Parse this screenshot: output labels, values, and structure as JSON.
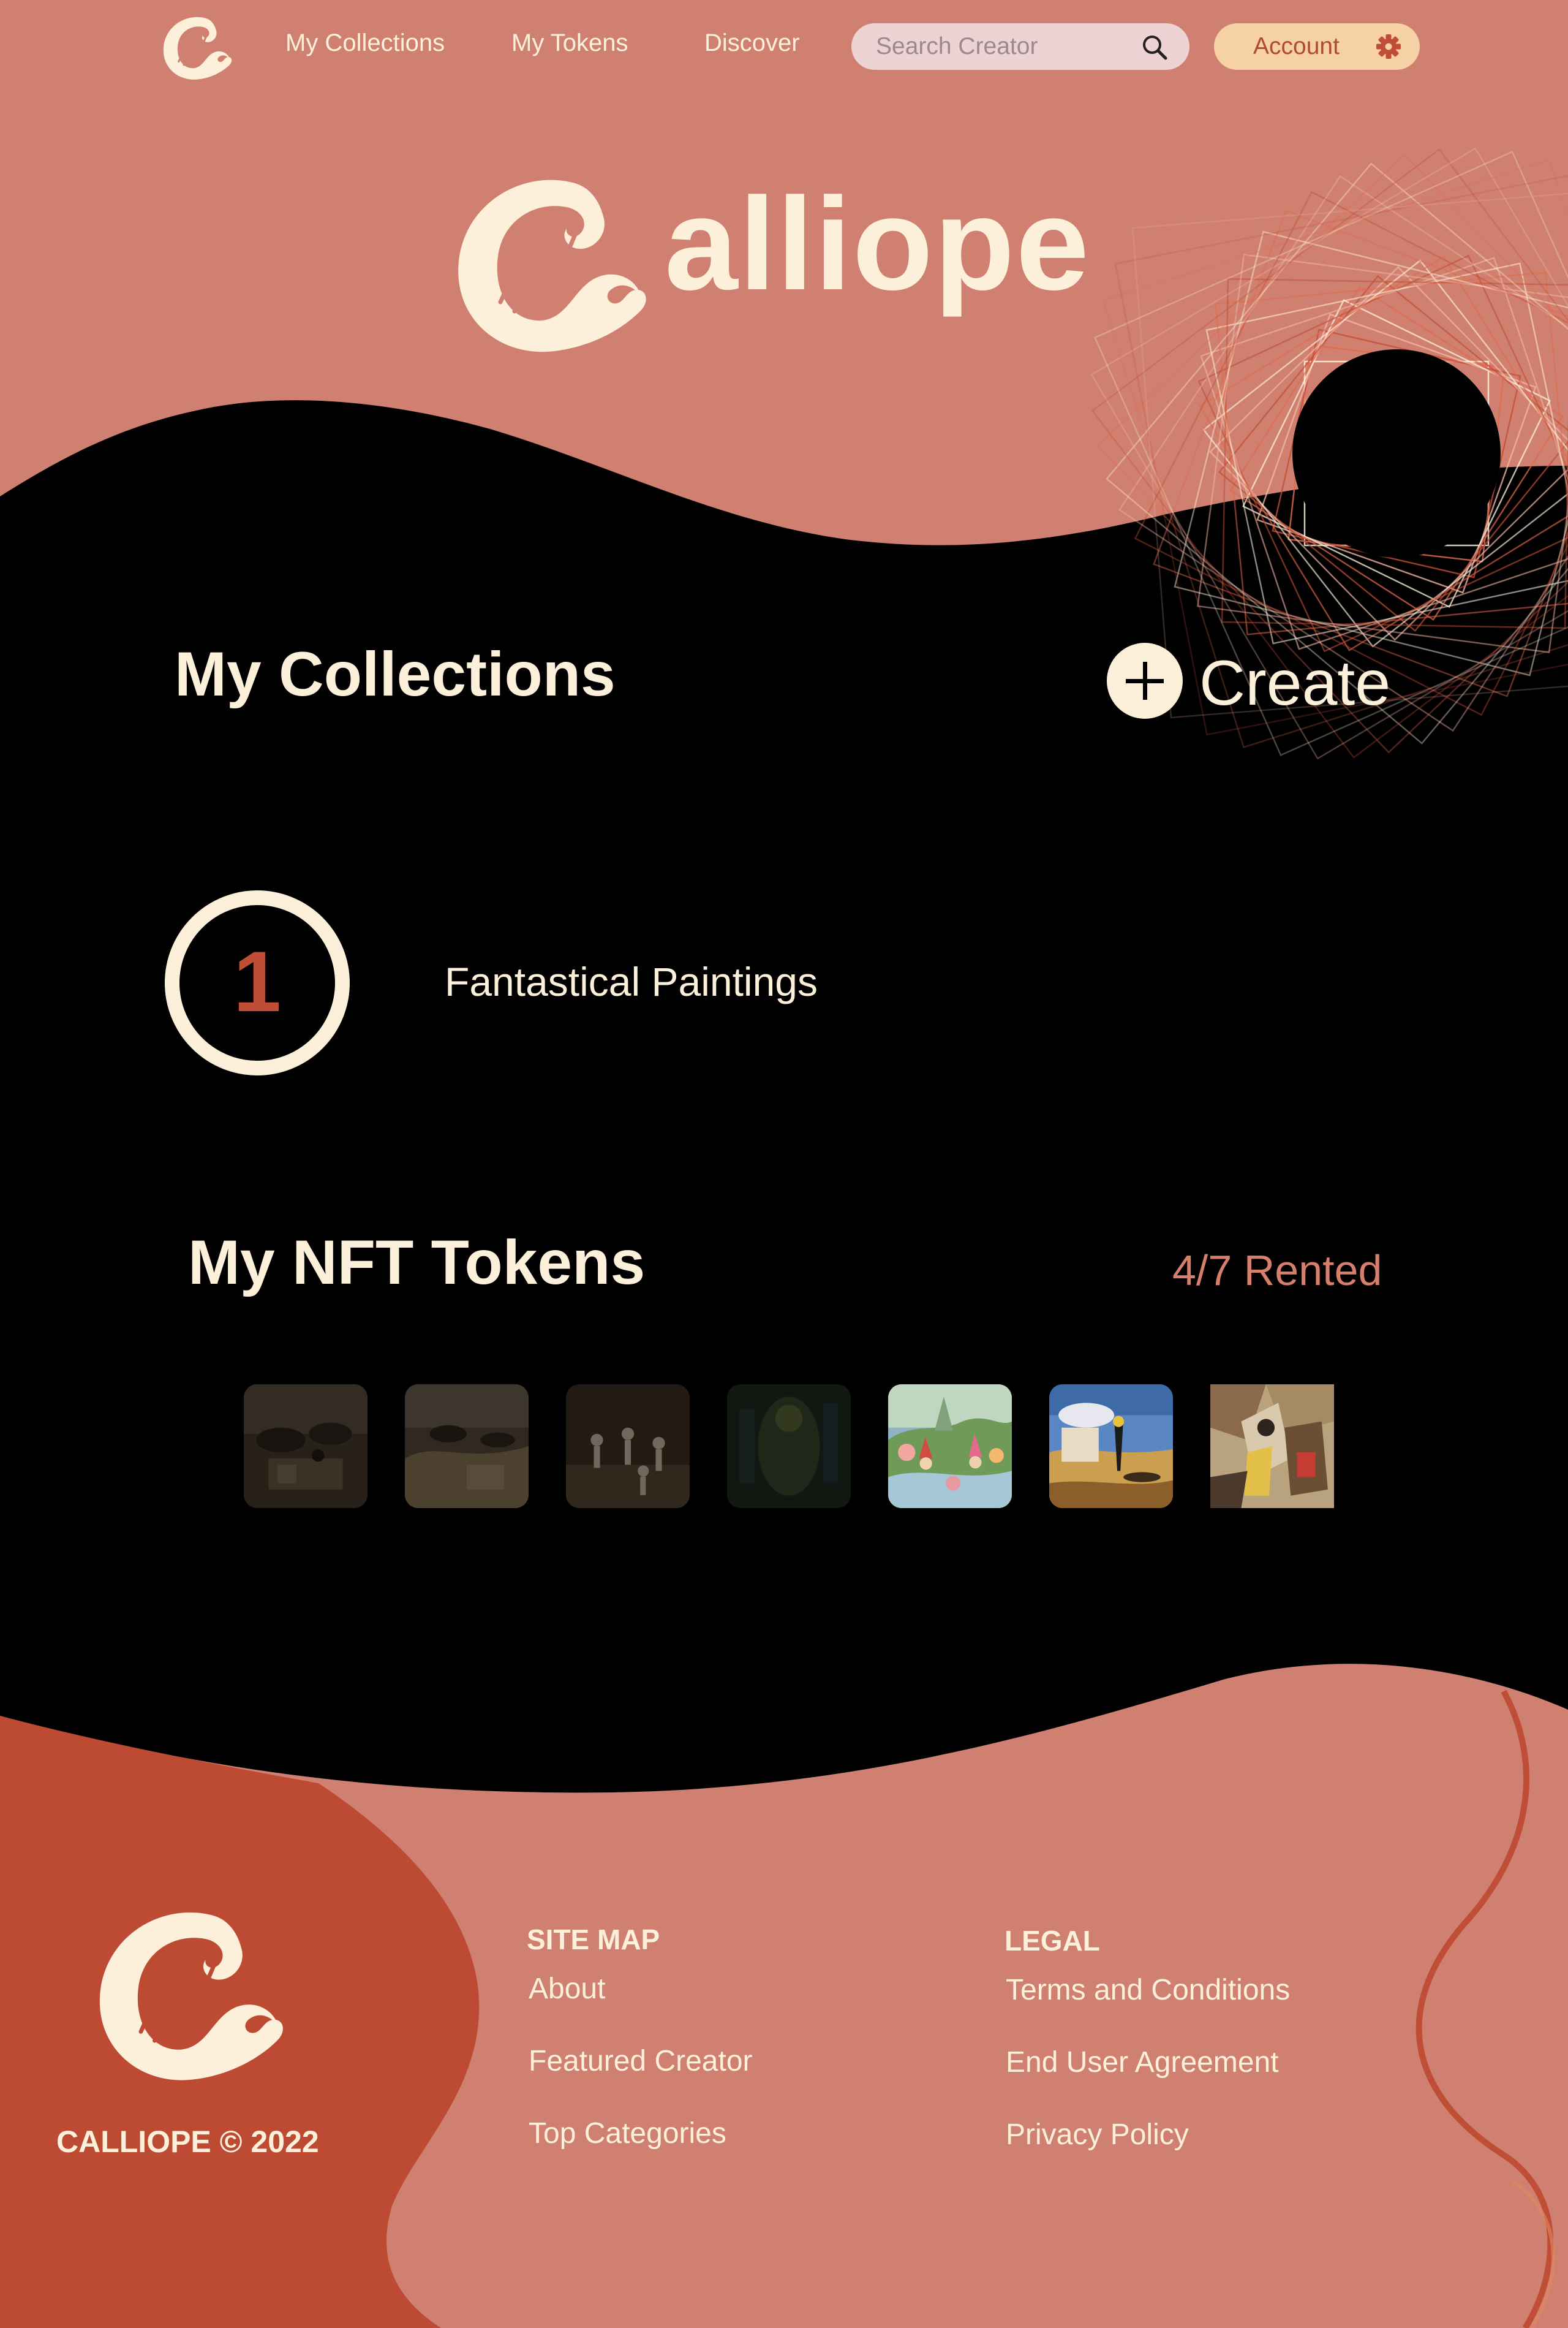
{
  "colors": {
    "salmon": "#d08070",
    "brick": "#bd4a33",
    "cream": "#fdf0da",
    "black": "#000000",
    "account_bg": "#f6d1a5",
    "search_bg": "#eed3d4"
  },
  "nav": {
    "logo_icon": "calliope-harp-logo-icon",
    "links": [
      "My Collections",
      "My Tokens",
      "Discover"
    ],
    "search": {
      "placeholder": "Search Creator",
      "icon": "search-icon"
    },
    "account": {
      "label": "Account",
      "icon": "gear-icon"
    }
  },
  "hero": {
    "word": "alliope",
    "logo_icon": "calliope-harp-logo-icon"
  },
  "collections": {
    "title": "My Collections",
    "create_label": "Create",
    "create_icon": "plus-icon",
    "items": [
      {
        "number": "1",
        "name": "Fantastical Paintings"
      }
    ]
  },
  "tokens": {
    "title": "My NFT Tokens",
    "rented": "4/7 Rented",
    "items": [
      {
        "art": "sepia-figures-scene",
        "dimmed": true
      },
      {
        "art": "sepia-desert-scene",
        "dimmed": true
      },
      {
        "art": "sepia-skeleton-scene",
        "dimmed": true
      },
      {
        "art": "dark-green-figure-scene",
        "dimmed": true
      },
      {
        "art": "colorful-gnome-village",
        "dimmed": false
      },
      {
        "art": "surreal-desert-landscape",
        "dimmed": false
      },
      {
        "art": "cubist-still-life",
        "dimmed": false
      }
    ]
  },
  "footer": {
    "copyright": "CALLIOPE © 2022",
    "sitemap": {
      "title": "SITE MAP",
      "links": [
        "About",
        "Featured Creator",
        "Top Categories"
      ]
    },
    "legal": {
      "title": "LEGAL",
      "links": [
        "Terms and Conditions",
        "End User Agreement",
        "Privacy Policy"
      ]
    }
  }
}
